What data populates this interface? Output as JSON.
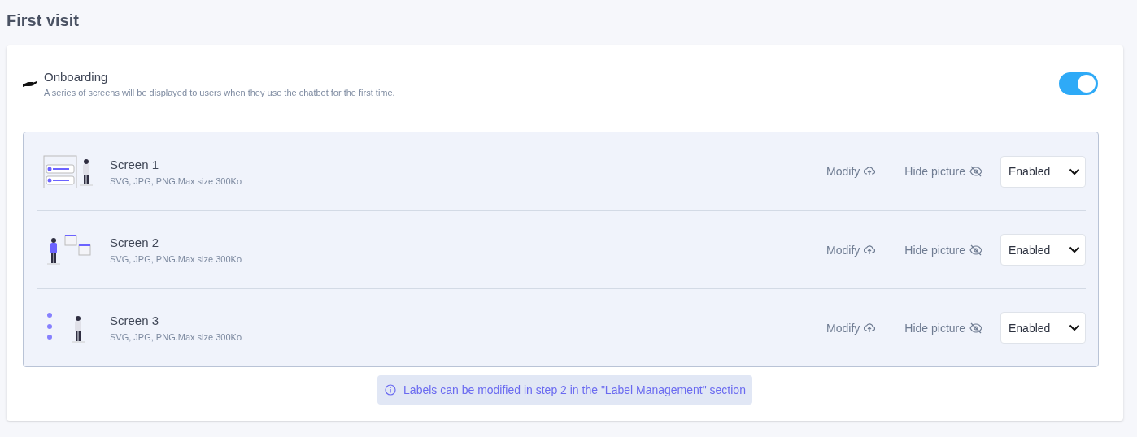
{
  "page": {
    "title": "First visit"
  },
  "onboarding": {
    "title": "Onboarding",
    "description": "A series of screens will be displayed to users when they use the chatbot for the first time.",
    "on": true
  },
  "screens": [
    {
      "title": "Screen 1",
      "hint": "SVG, JPG, PNG.Max size 300Ko",
      "modify": "Modify",
      "hide": "Hide picture",
      "status": "Enabled"
    },
    {
      "title": "Screen 2",
      "hint": "SVG, JPG, PNG.Max size 300Ko",
      "modify": "Modify",
      "hide": "Hide picture",
      "status": "Enabled"
    },
    {
      "title": "Screen 3",
      "hint": "SVG, JPG, PNG.Max size 300Ko",
      "modify": "Modify",
      "hide": "Hide picture",
      "status": "Enabled"
    }
  ],
  "info": "Labels can be modified in step 2 in the \"Label Management\" section"
}
